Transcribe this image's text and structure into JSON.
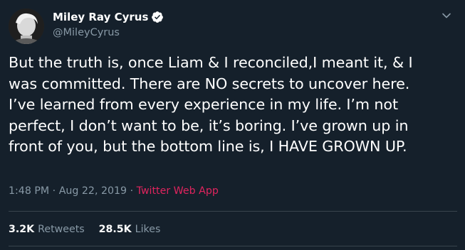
{
  "tweet": {
    "display_name": "Miley Ray Cyrus",
    "handle": "@MileyCyrus",
    "text": "But the truth is, once Liam & I reconciled,I meant it, & I\nwas committed. There are NO secrets to uncover here.\nI’ve learned from every experience in my life. I’m not\nperfect, I don’t want to be, it’s boring. I’ve grown up in\nfront of you, but the bottom line is, I HAVE GROWN UP.",
    "timestamp": "1:48 PM · Aug 22, 2019",
    "separator": " · ",
    "source": "Twitter Web App",
    "retweets_count": "3.2K",
    "retweets_label": "Retweets",
    "likes_count": "28.5K",
    "likes_label": "Likes"
  },
  "icons": {
    "verified": "verified-badge-icon",
    "more": "chevron-down-icon"
  },
  "colors": {
    "background": "#15202b",
    "secondary_text": "#8899a6",
    "source_link": "#e0245e",
    "divider": "#38444d"
  }
}
